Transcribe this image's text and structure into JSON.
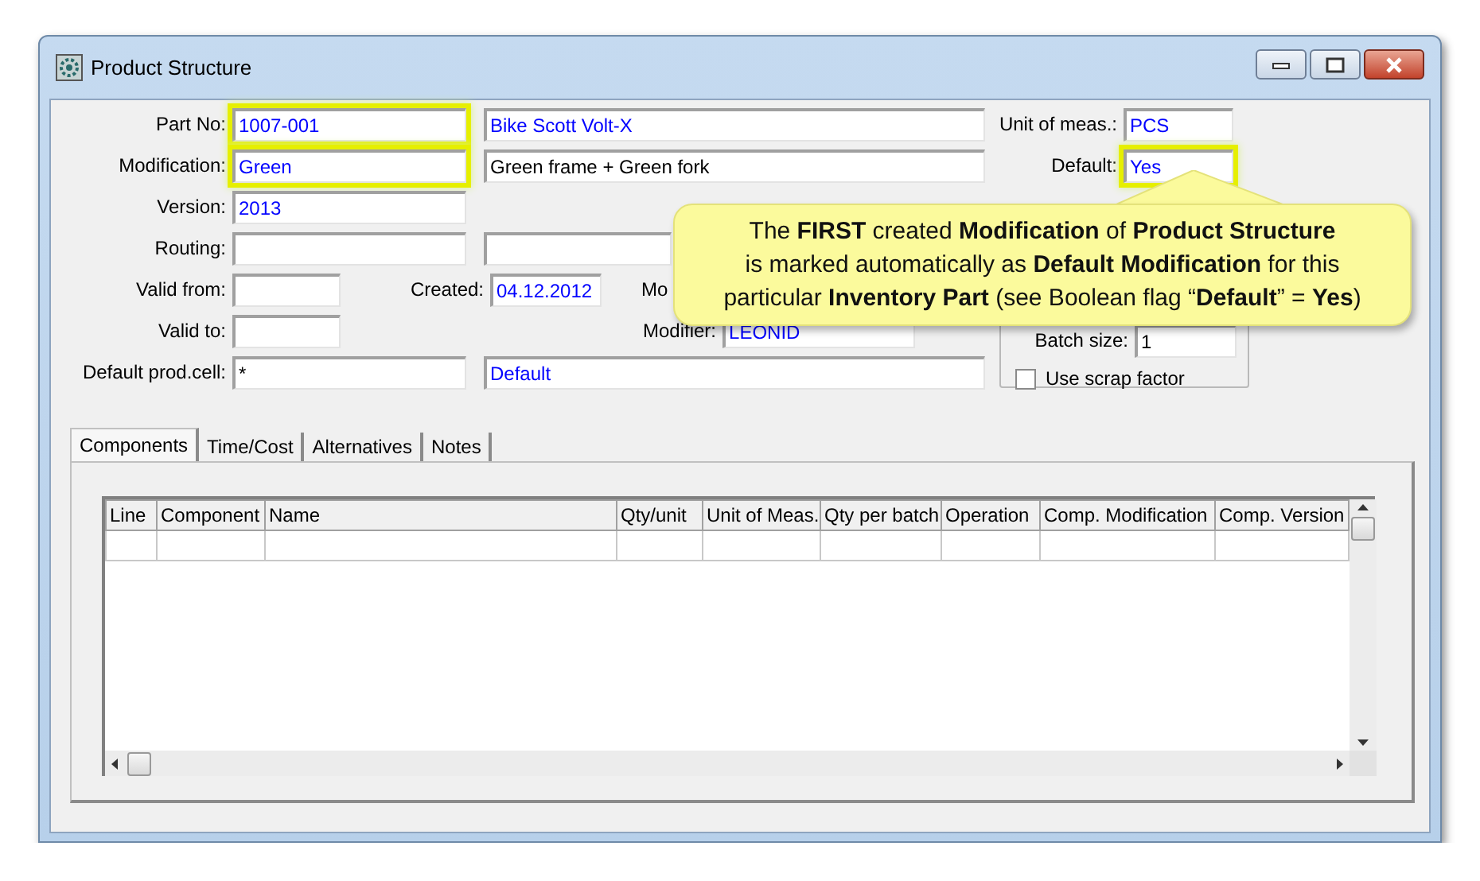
{
  "window": {
    "title": "Product Structure"
  },
  "form": {
    "part_no": {
      "label": "Part No:",
      "value": "1007-001",
      "highlighted": true
    },
    "part_description": {
      "value": "Bike Scott Volt-X"
    },
    "unit_of_meas": {
      "label": "Unit of meas.:",
      "value": "PCS"
    },
    "modification": {
      "label": "Modification:",
      "value": "Green",
      "highlighted": true
    },
    "modification_description": {
      "value": "Green frame + Green fork"
    },
    "default": {
      "label": "Default:",
      "value": "Yes",
      "highlighted": true
    },
    "version": {
      "label": "Version:",
      "value": "2013"
    },
    "routing": {
      "label": "Routing:"
    },
    "valid_from": {
      "label": "Valid from:"
    },
    "created": {
      "label": "Created:",
      "value": "04.12.2012"
    },
    "modified": {
      "label": "Mo"
    },
    "valid_to": {
      "label": "Valid to:"
    },
    "modifier": {
      "label": "Modifier:",
      "value": "LEONID"
    },
    "default_prod_cell": {
      "label": "Default prod.cell:",
      "value": "*"
    },
    "prod_cell_description": {
      "value": "Default"
    },
    "batch_size": {
      "label": "Batch size:",
      "value": "1"
    },
    "use_scrap_factor": {
      "label": "Use scrap factor",
      "checked": false
    }
  },
  "tabs": [
    {
      "label": "Components",
      "selected": true
    },
    {
      "label": "Time/Cost",
      "selected": false
    },
    {
      "label": "Alternatives",
      "selected": false
    },
    {
      "label": "Notes",
      "selected": false
    }
  ],
  "table": {
    "columns": [
      "Line",
      "Component",
      "Name",
      "Qty/unit",
      "Unit of Meas.",
      "Qty per batch",
      "Operation",
      "Comp. Modification",
      "Comp. Version"
    ]
  },
  "callout": {
    "lines": [
      "The **FIRST** created **Modification** of **Product Structure**",
      "is marked automatically as **Default Modification** for this",
      "particular **Inventory Part** (see Boolean flag “**Default**” = **Yes**)"
    ]
  }
}
